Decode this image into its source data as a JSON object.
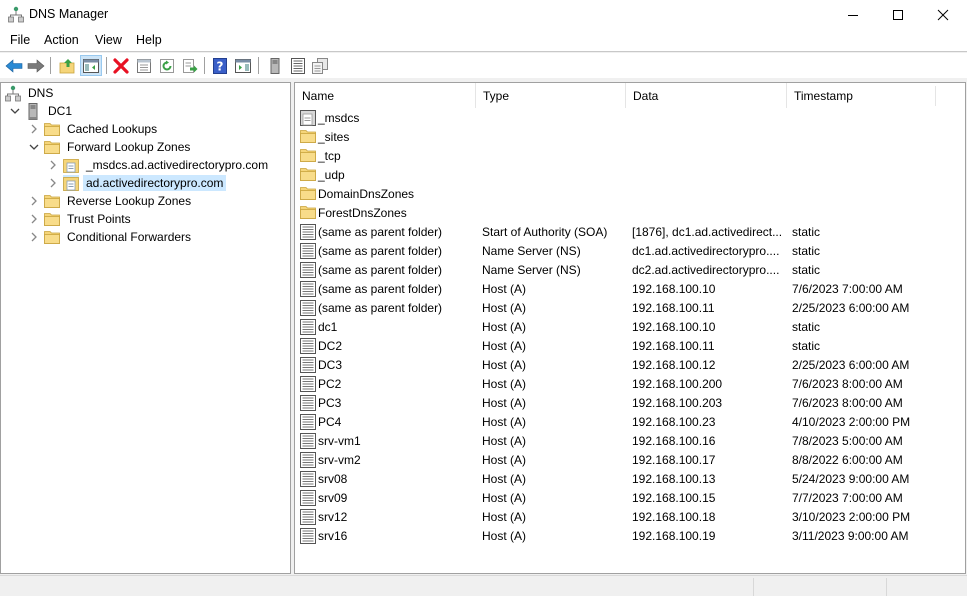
{
  "window": {
    "title": "DNS Manager",
    "icons": {
      "app": "dns-manager-icon",
      "minimize": "minimize-icon",
      "maximize": "maximize-icon",
      "close": "close-icon"
    }
  },
  "menu": {
    "items": [
      {
        "label": "File"
      },
      {
        "label": "Action"
      },
      {
        "label": "View"
      },
      {
        "label": "Help"
      }
    ]
  },
  "toolbar": {
    "buttons": [
      {
        "name": "back",
        "icon": "back-arrow-icon"
      },
      {
        "name": "forward",
        "icon": "forward-arrow-icon"
      },
      {
        "name": "up-one-level",
        "icon": "folder-up-icon"
      },
      {
        "name": "show-hide-console-tree",
        "icon": "console-tree-icon",
        "active": true
      },
      {
        "name": "delete",
        "icon": "delete-icon"
      },
      {
        "name": "properties",
        "icon": "properties-icon"
      },
      {
        "name": "refresh",
        "icon": "refresh-icon"
      },
      {
        "name": "export-list",
        "icon": "export-list-icon"
      },
      {
        "name": "help",
        "icon": "help-icon"
      },
      {
        "name": "show-hide-action-pane",
        "icon": "action-pane-icon"
      },
      {
        "name": "server",
        "icon": "server-icon"
      },
      {
        "name": "list-records",
        "icon": "record-list-icon"
      },
      {
        "name": "copy-records",
        "icon": "copy-records-icon"
      }
    ]
  },
  "tree": {
    "items": [
      {
        "label": "DNS",
        "icon": "dns-icon",
        "level": 0,
        "expander": "none"
      },
      {
        "label": "DC1",
        "icon": "server-icon",
        "level": 1,
        "expander": "expanded"
      },
      {
        "label": "Cached Lookups",
        "icon": "folder-icon",
        "level": 2,
        "expander": "collapsed"
      },
      {
        "label": "Forward Lookup Zones",
        "icon": "folder-icon",
        "level": 2,
        "expander": "expanded"
      },
      {
        "label": "_msdcs.ad.activedirectorypro.com",
        "icon": "zone-icon",
        "level": 3,
        "expander": "collapsed"
      },
      {
        "label": "ad.activedirectorypro.com",
        "icon": "zone-icon",
        "level": 3,
        "expander": "collapsed",
        "selected": true
      },
      {
        "label": "Reverse Lookup Zones",
        "icon": "folder-icon",
        "level": 2,
        "expander": "collapsed"
      },
      {
        "label": "Trust Points",
        "icon": "folder-icon",
        "level": 2,
        "expander": "collapsed"
      },
      {
        "label": "Conditional Forwarders",
        "icon": "folder-icon",
        "level": 2,
        "expander": "collapsed"
      }
    ]
  },
  "records": {
    "columns": [
      "Name",
      "Type",
      "Data",
      "Timestamp"
    ],
    "rows": [
      {
        "name": "_msdcs",
        "type": "",
        "data": "",
        "timestamp": "",
        "icon": "delegated-zone-icon"
      },
      {
        "name": "_sites",
        "type": "",
        "data": "",
        "timestamp": "",
        "icon": "folder-icon"
      },
      {
        "name": "_tcp",
        "type": "",
        "data": "",
        "timestamp": "",
        "icon": "folder-icon"
      },
      {
        "name": "_udp",
        "type": "",
        "data": "",
        "timestamp": "",
        "icon": "folder-icon"
      },
      {
        "name": "DomainDnsZones",
        "type": "",
        "data": "",
        "timestamp": "",
        "icon": "folder-icon"
      },
      {
        "name": "ForestDnsZones",
        "type": "",
        "data": "",
        "timestamp": "",
        "icon": "folder-icon"
      },
      {
        "name": "(same as parent folder)",
        "type": "Start of Authority (SOA)",
        "data": "[1876], dc1.ad.activedirect...",
        "timestamp": "static",
        "icon": "record-icon"
      },
      {
        "name": "(same as parent folder)",
        "type": "Name Server (NS)",
        "data": "dc1.ad.activedirectorypro....",
        "timestamp": "static",
        "icon": "record-icon"
      },
      {
        "name": "(same as parent folder)",
        "type": "Name Server (NS)",
        "data": "dc2.ad.activedirectorypro....",
        "timestamp": "static",
        "icon": "record-icon"
      },
      {
        "name": "(same as parent folder)",
        "type": "Host (A)",
        "data": "192.168.100.10",
        "timestamp": "7/6/2023 7:00:00 AM",
        "icon": "record-icon"
      },
      {
        "name": "(same as parent folder)",
        "type": "Host (A)",
        "data": "192.168.100.11",
        "timestamp": "2/25/2023 6:00:00 AM",
        "icon": "record-icon"
      },
      {
        "name": "dc1",
        "type": "Host (A)",
        "data": "192.168.100.10",
        "timestamp": "static",
        "icon": "record-icon"
      },
      {
        "name": "DC2",
        "type": "Host (A)",
        "data": "192.168.100.11",
        "timestamp": "static",
        "icon": "record-icon"
      },
      {
        "name": "DC3",
        "type": "Host (A)",
        "data": "192.168.100.12",
        "timestamp": "2/25/2023 6:00:00 AM",
        "icon": "record-icon"
      },
      {
        "name": "PC2",
        "type": "Host (A)",
        "data": "192.168.100.200",
        "timestamp": "7/6/2023 8:00:00 AM",
        "icon": "record-icon"
      },
      {
        "name": "PC3",
        "type": "Host (A)",
        "data": "192.168.100.203",
        "timestamp": "7/6/2023 8:00:00 AM",
        "icon": "record-icon"
      },
      {
        "name": "PC4",
        "type": "Host (A)",
        "data": "192.168.100.23",
        "timestamp": "4/10/2023 2:00:00 PM",
        "icon": "record-icon"
      },
      {
        "name": "srv-vm1",
        "type": "Host (A)",
        "data": "192.168.100.16",
        "timestamp": "7/8/2023 5:00:00 AM",
        "icon": "record-icon"
      },
      {
        "name": "srv-vm2",
        "type": "Host (A)",
        "data": "192.168.100.17",
        "timestamp": "8/8/2022 6:00:00 AM",
        "icon": "record-icon"
      },
      {
        "name": "srv08",
        "type": "Host (A)",
        "data": "192.168.100.13",
        "timestamp": "5/24/2023 9:00:00 AM",
        "icon": "record-icon"
      },
      {
        "name": "srv09",
        "type": "Host (A)",
        "data": "192.168.100.15",
        "timestamp": "7/7/2023 7:00:00 AM",
        "icon": "record-icon"
      },
      {
        "name": "srv12",
        "type": "Host (A)",
        "data": "192.168.100.18",
        "timestamp": "3/10/2023 2:00:00 PM",
        "icon": "record-icon"
      },
      {
        "name": "srv16",
        "type": "Host (A)",
        "data": "192.168.100.19",
        "timestamp": "3/11/2023 9:00:00 AM",
        "icon": "record-icon"
      }
    ]
  },
  "colors": {
    "selection": "#cce8ff",
    "toolbar_active": "#cce4f7",
    "folder": "#f5d57a",
    "delete_red": "#e81123",
    "arrow_blue": "#2a8ad4"
  }
}
